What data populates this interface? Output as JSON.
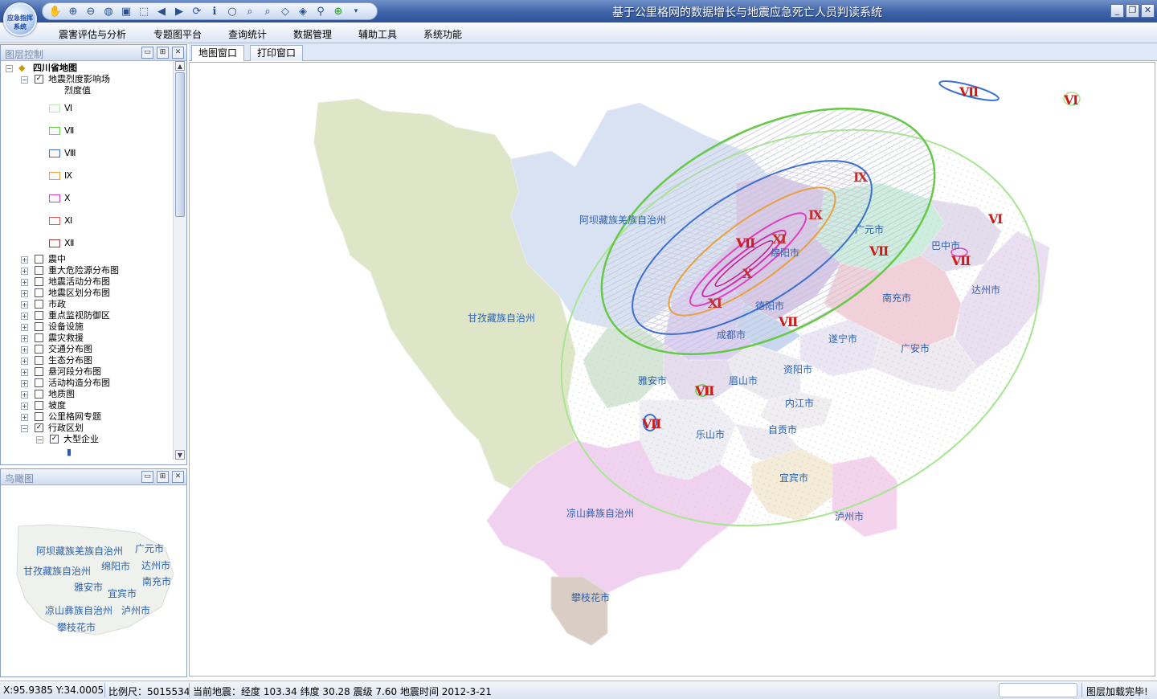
{
  "app": {
    "title": "基于公里格网的数据增长与地震应急死亡人员判读系统",
    "logo_text": "应急指挥系统"
  },
  "toolbar": {
    "icons": [
      "pan-hand-icon",
      "zoom-in-icon",
      "zoom-out-icon",
      "globe-icon",
      "full-extent-icon",
      "select-box-icon",
      "back-icon",
      "forward-icon",
      "refresh-icon",
      "info-icon",
      "circle-select-icon",
      "rect-zoom-icon",
      "magnify-icon",
      "eraser-icon",
      "clear-icon",
      "measure-icon",
      "add-icon",
      "dropdown-icon"
    ]
  },
  "window_controls": {
    "minimize": "_",
    "restore": "❐",
    "close": "✕"
  },
  "menu": [
    "震害评估与分析",
    "专题图平台",
    "查询统计",
    "数据管理",
    "辅助工具",
    "系统功能"
  ],
  "layer_panel": {
    "title": "图层控制",
    "root": "四川省地图",
    "intensity_layer": "地震烈度影响场",
    "field_label": "烈度值",
    "legend": [
      {
        "label": "Ⅵ",
        "color": "#b8ecb0"
      },
      {
        "label": "Ⅶ",
        "color": "#6cd24a"
      },
      {
        "label": "Ⅷ",
        "color": "#3b6fd0"
      },
      {
        "label": "Ⅸ",
        "color": "#e8a040"
      },
      {
        "label": "Ⅹ",
        "color": "#e040c0"
      },
      {
        "label": "Ⅺ",
        "color": "#e05a5a"
      },
      {
        "label": "Ⅻ",
        "color": "#9a3a3a"
      }
    ],
    "layers": [
      "震中",
      "重大危险源分布图",
      "地震活动分布图",
      "地震区划分布图",
      "市政",
      "重点监视防御区",
      "设备设施",
      "震灾救援",
      "交通分布图",
      "生态分布图",
      "悬河段分布图",
      "活动构造分布图",
      "地质图",
      "坡度",
      "公里格网专题",
      "行政区划"
    ],
    "sublayer": "大型企业"
  },
  "overview_panel": {
    "title": "鸟瞰图",
    "labels": [
      "阿坝藏族羌族自治州",
      "广元市",
      "甘孜藏族自治州",
      "绵阳市",
      "达州市",
      "雅安市",
      "南充市",
      "宜宾市",
      "凉山彝族自治州",
      "泸州市",
      "攀枝花市"
    ]
  },
  "tabs": [
    "地图窗口",
    "打印窗口"
  ],
  "map": {
    "region_labels": [
      "阿坝藏族羌族自治州",
      "甘孜藏族自治州",
      "广元市",
      "巴中市",
      "绵阳市",
      "达州市",
      "德阳市",
      "南充市",
      "成都市",
      "遂宁市",
      "广安市",
      "雅安市",
      "眉山市",
      "资阳市",
      "内江市",
      "乐山市",
      "自贡市",
      "宜宾市",
      "凉山彝族自治州",
      "泸州市",
      "攀枝花市"
    ],
    "intensity_labels": [
      "Ⅶ",
      "Ⅵ",
      "Ⅸ",
      "Ⅸ",
      "Ⅺ",
      "Ⅶ",
      "Ⅶ",
      "Ⅵ",
      "Ⅹ",
      "Ⅶ",
      "Ⅺ",
      "Ⅶ",
      "Ⅶ",
      "Ⅶ"
    ]
  },
  "status": {
    "coords": "X:95.9385  Y:34.0005",
    "scale": "比例尺：5015534",
    "quake": "当前地震：经度 103.34 纬度 30.28 震级 7.60 地震时间 2012-3-21",
    "load_status": "图层加载完毕!"
  }
}
